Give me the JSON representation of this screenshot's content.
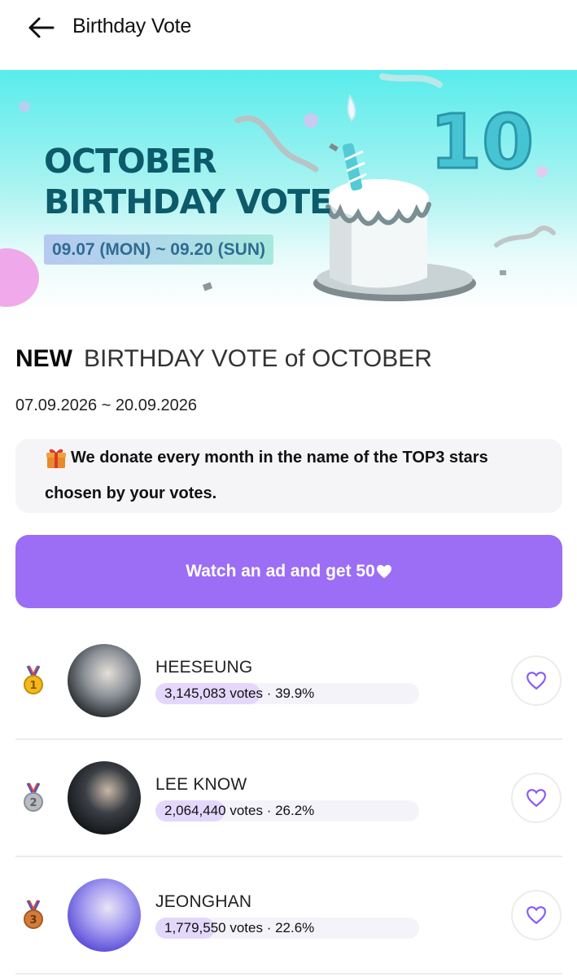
{
  "header": {
    "back_icon": "arrow-left-icon",
    "title": "Birthday Vote"
  },
  "banner": {
    "line1": "OCTOBER",
    "line2": "BIRTHDAY VOTE",
    "dates": "09.07 (MON) ~ 09.20 (SUN)",
    "number": "10",
    "colors": {
      "accent_text": "#0d5b6a",
      "sky": "#58ecec"
    }
  },
  "section": {
    "new_tag": "NEW",
    "title": "BIRTHDAY VOTE of OCTOBER",
    "dates": "07.09.2026 ~ 20.09.2026"
  },
  "notice": {
    "icon": "gift-icon",
    "line1": "We donate every month in the name of the TOP3 stars",
    "line2": "chosen by your votes."
  },
  "ad_button": {
    "label": "Watch an ad and get 50",
    "icon": "heart-icon",
    "color": "#9b6ef5"
  },
  "rankings": [
    {
      "rank": 1,
      "medal": "gold-medal-icon",
      "name": "HEESEUNG",
      "votes": "3,145,083 votes · 39.9%",
      "percent": 39.9
    },
    {
      "rank": 2,
      "medal": "silver-medal-icon",
      "name": "LEE KNOW",
      "votes": "2,064,440 votes · 26.2%",
      "percent": 26.2
    },
    {
      "rank": 3,
      "medal": "bronze-medal-icon",
      "name": "JEONGHAN",
      "votes": "1,779,550 votes · 22.6%",
      "percent": 22.6
    }
  ]
}
